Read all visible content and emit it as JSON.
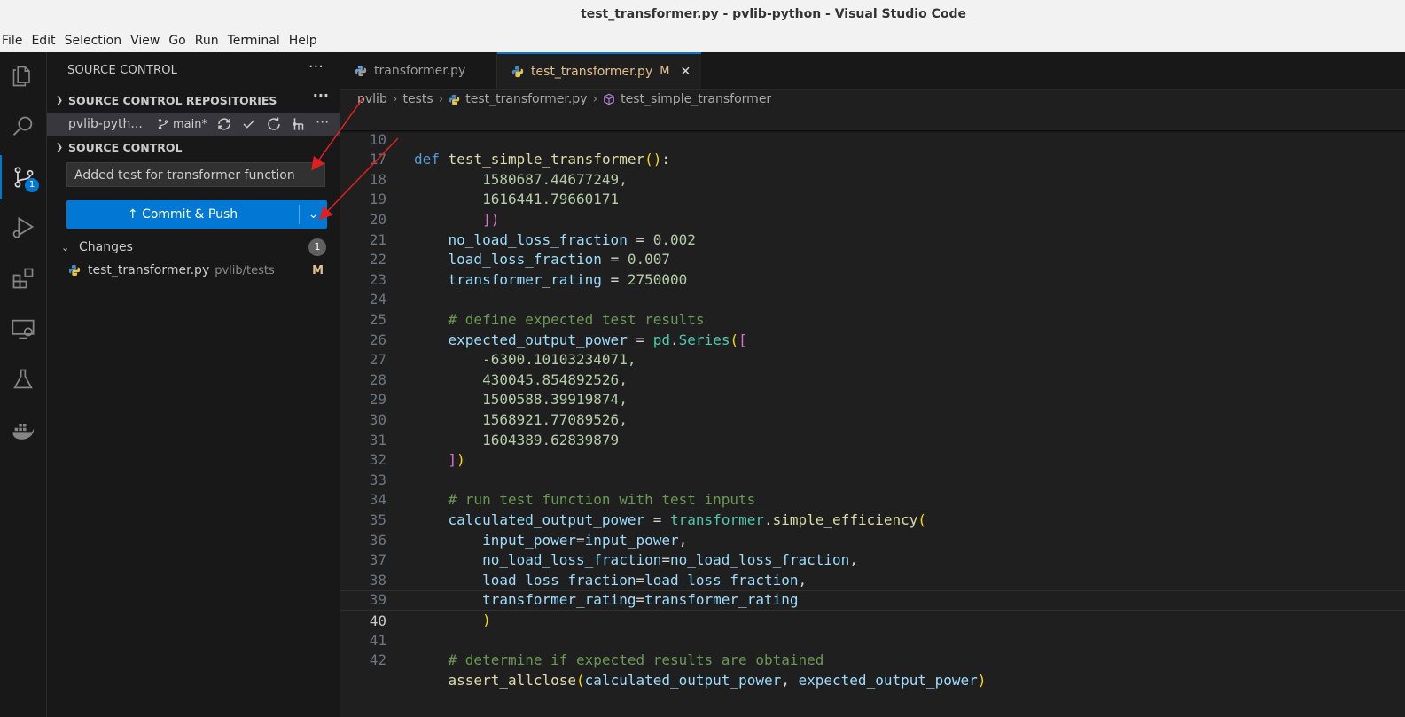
{
  "window": {
    "title": "test_transformer.py - pvlib-python - Visual Studio Code"
  },
  "menu": [
    "File",
    "Edit",
    "Selection",
    "View",
    "Go",
    "Run",
    "Terminal",
    "Help"
  ],
  "activity": {
    "scm_badge": "1"
  },
  "sidebar": {
    "title": "SOURCE CONTROL",
    "more": "···",
    "repos_header": "SOURCE CONTROL REPOSITORIES",
    "repo_name": "pvlib-pyth...",
    "branch": "main*",
    "scm_header": "SOURCE CONTROL",
    "commit_message": "Added test for transformer function",
    "commit_button": "Commit & Push",
    "changes_label": "Changes",
    "changes_count": "1",
    "file": {
      "name": "test_transformer.py",
      "path": "pvlib/tests",
      "status": "M"
    }
  },
  "tabs": [
    {
      "label": "transformer.py"
    },
    {
      "label": "test_transformer.py",
      "status": "M"
    }
  ],
  "breadcrumbs": [
    "pvlib",
    "tests",
    "test_transformer.py",
    "test_simple_transformer"
  ],
  "editor": {
    "line_numbers": [
      "10",
      "17",
      "18",
      "19",
      "20",
      "21",
      "22",
      "23",
      "24",
      "25",
      "26",
      "27",
      "28",
      "29",
      "30",
      "31",
      "32",
      "33",
      "34",
      "35",
      "36",
      "37",
      "38",
      "39",
      "40",
      "41",
      "42"
    ],
    "current_line": "40",
    "code": {
      "sticky_def": "def",
      "sticky_fn": "test_simple_transformer",
      "l17": "1580687.44677249,",
      "l18": "1616441.79660171",
      "l20_var": "no_load_loss_fraction",
      "l20_val": "0.002",
      "l21_var": "load_loss_fraction",
      "l21_val": "0.007",
      "l22_var": "transformer_rating",
      "l22_val": "2750000",
      "l24": "# define expected test results",
      "l25_var": "expected_output_power",
      "l25_mod": "pd",
      "l25_cls": "Series",
      "l26": "-6300.10103234071,",
      "l27": "430045.854892526,",
      "l28": "1500588.39919874,",
      "l29": "1568921.77089526,",
      "l30": "1604389.62839879",
      "l33": "# run test function with test inputs",
      "l34_var": "calculated_output_power",
      "l34_mod": "transformer",
      "l34_fn": "simple_efficiency",
      "l35_k": "input_power",
      "l35_v": "input_power",
      "l36_k": "no_load_loss_fraction",
      "l36_v": "no_load_loss_fraction",
      "l37_k": "load_loss_fraction",
      "l37_v": "load_loss_fraction",
      "l38_k": "transformer_rating",
      "l38_v": "transformer_rating",
      "l41": "# determine if expected results are obtained",
      "l42_fn": "assert_allclose",
      "l42_a": "calculated_output_power",
      "l42_b": "expected_output_power"
    }
  },
  "colors": {
    "accent": "#0078d4",
    "modified": "#e2c08d",
    "annotation_arrow": "#e02020"
  }
}
